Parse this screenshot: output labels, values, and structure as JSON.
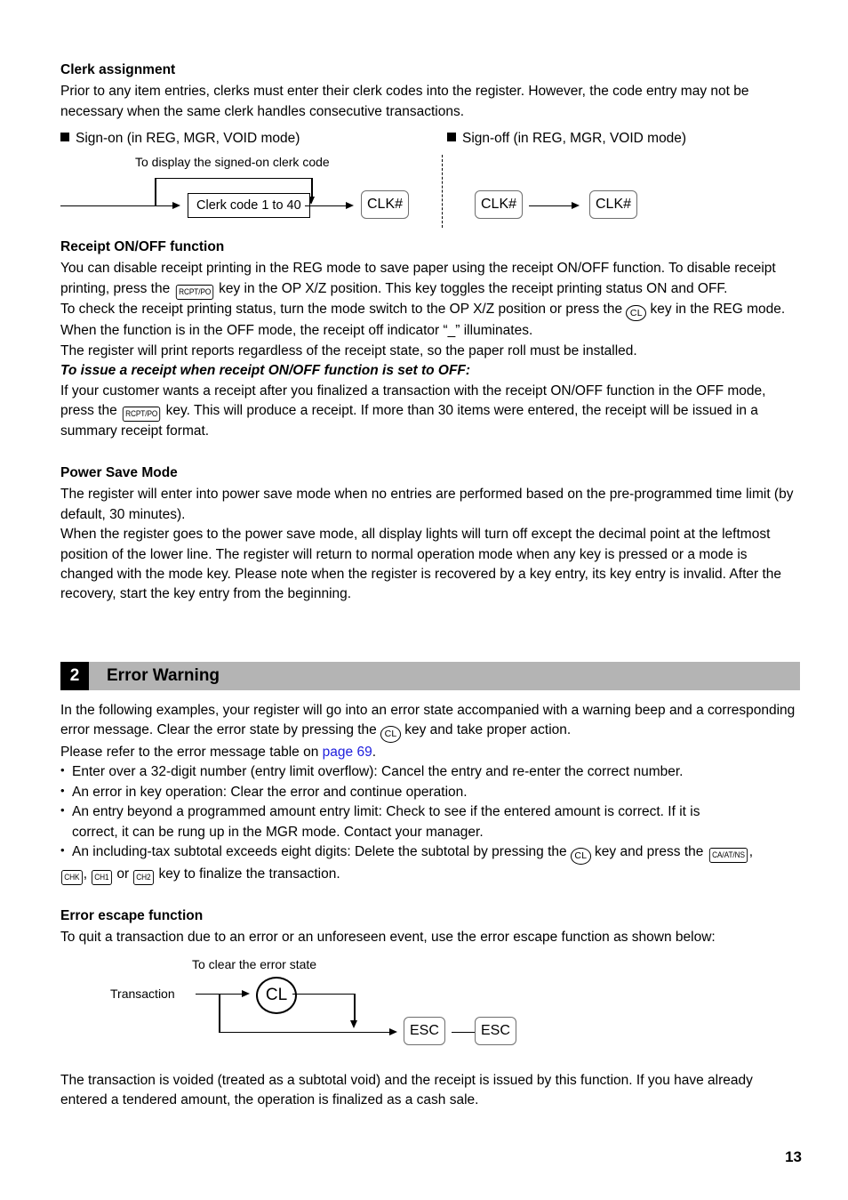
{
  "page": {
    "number": "13"
  },
  "clerk_assignment": {
    "heading": "Clerk assignment",
    "paragraph": "Prior to any item entries, clerks must enter their clerk codes into the register.  However, the code entry may not be necessary when the same clerk handles consecutive transactions.",
    "signon_label": "Sign-on (in REG, MGR, VOID mode)",
    "signoff_label": "Sign-off (in REG, MGR, VOID mode)",
    "diagram": {
      "branch_caption": "To display the signed-on clerk code",
      "code_box": "Clerk code 1 to 40",
      "clk_key": "CLK#",
      "signoff_key_1": "CLK#",
      "signoff_key_2": "CLK#"
    }
  },
  "receipt_function": {
    "heading": "Receipt ON/OFF function",
    "p1_a": "You can disable receipt printing in the REG mode to save paper using the receipt ON/OFF function. To disable receipt printing, press the ",
    "p1_key": "RCPT/PO",
    "p1_b": " key in the OP X/Z position.  This key toggles the receipt printing status ON and OFF.",
    "p2_a": "To check the receipt printing status, turn the mode switch to the OP X/Z position or press the ",
    "p2_key": "CL",
    "p2_b": " key in the REG mode. When the function is in the OFF mode, the receipt off indicator “_” illuminates.",
    "p3": "The register will print reports regardless of the receipt state, so the paper roll must be installed.",
    "italic_heading": "To issue a receipt when receipt ON/OFF function is set to OFF:",
    "p4_a": "If your customer wants a receipt after you finalized a transaction with the receipt ON/OFF function in the OFF mode, press the ",
    "p4_key": "RCPT/PO",
    "p4_b": " key.  This will produce a receipt.  If more than 30 items were entered, the receipt will be issued in a summary receipt format."
  },
  "power_save": {
    "heading": "Power Save Mode",
    "p1": "The register will enter into power save mode when no entries are performed based on the pre-programmed time limit (by default, 30 minutes).",
    "p2": "When the register goes to the power save mode, all display lights will turn off except the decimal point at the leftmost position of the lower line.  The register will return to normal operation mode when any key is pressed or a mode is changed with the mode key.  Please note when the register is recovered by a key entry, its key entry is invalid.  After the recovery, start the key entry from the beginning."
  },
  "error_warning": {
    "section_number": "2",
    "title": "Error Warning",
    "intro_a": "In the following examples, your register will go into an error state accompanied with a warning beep and a corresponding error message.  Clear the error state by pressing the ",
    "intro_key": "CL",
    "intro_b": " key and take proper action.",
    "intro_c": "Please refer to the error message table on ",
    "intro_link": "page 69",
    "intro_d": ".",
    "bullets": [
      "Enter over a 32-digit number (entry limit overflow): Cancel the entry and re-enter the correct number.",
      "An error in key operation: Clear the error and continue operation."
    ],
    "bullet3_line1": "An entry beyond a programmed amount entry limit: Check to see if the entered amount is correct.  If it is",
    "bullet3_line2": "correct, it can be rung up in the MGR mode.  Contact your manager.",
    "bullet4_a": "An including-tax subtotal exceeds eight digits: Delete the subtotal by pressing the ",
    "bullet4_key_cl": "CL",
    "bullet4_b": " key and press the ",
    "bullet4_key_caatns": "CA/AT/NS",
    "bullet4_c": ", ",
    "bullet4_key_chk": "CHK",
    "bullet4_d": ", ",
    "bullet4_key_ch1": "CH1",
    "bullet4_e": " or ",
    "bullet4_key_ch2": "CH2",
    "bullet4_f": " key to finalize the transaction."
  },
  "error_escape": {
    "heading": "Error escape function",
    "intro": "To quit a transaction due to an error or an unforeseen event, use the error escape function as shown below:",
    "diagram": {
      "transaction_label": "Transaction",
      "branch_caption": "To clear the error state",
      "cl_key": "CL",
      "esc_key_1": "ESC",
      "esc_key_2": "ESC"
    },
    "closing": "The transaction is voided (treated as a subtotal void) and the receipt is issued by this function.  If you have already entered a tendered amount, the operation is finalized as a cash sale."
  }
}
